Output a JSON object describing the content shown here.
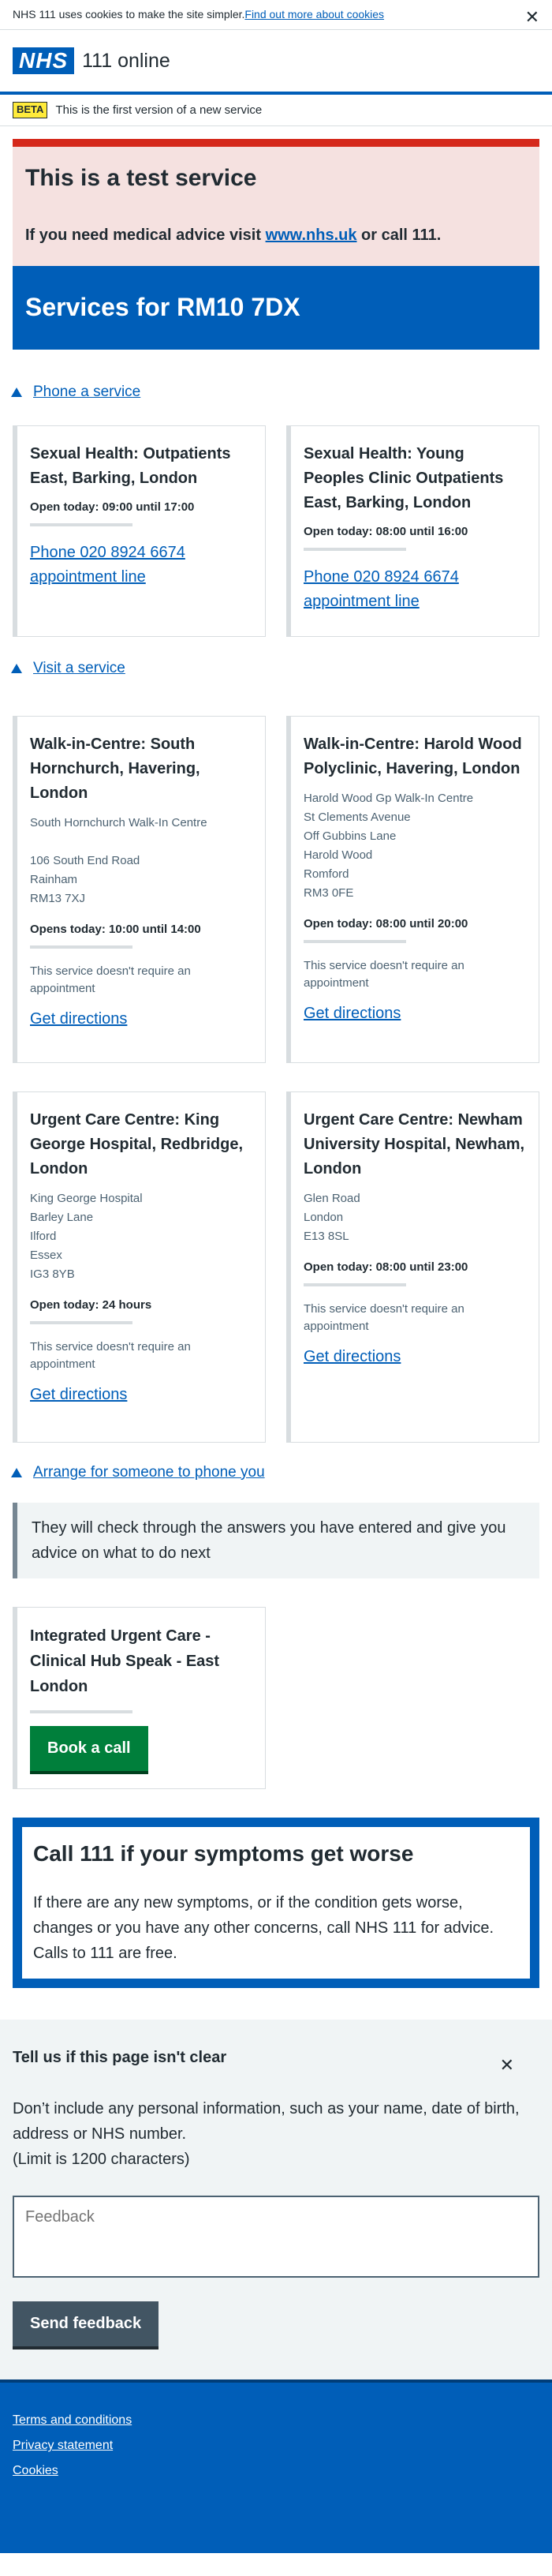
{
  "cookie_banner": {
    "text": "NHS 111 uses cookies to make the site simpler. ",
    "link": "Find out more about cookies",
    "close": "✕"
  },
  "header": {
    "logo": "NHS",
    "service_name": "111 online"
  },
  "beta": {
    "tag": "BETA",
    "text": "This is the first version of a new service"
  },
  "test_banner": {
    "title": "This is a test service",
    "text_before": "If you need medical advice visit ",
    "link": "www.nhs.uk",
    "text_after": " or call 111."
  },
  "services_title": "Services for RM10 7DX",
  "phone_section": {
    "toggle": "Phone a service",
    "cards": [
      {
        "title": "Sexual Health: Outpatients East, Barking, London",
        "open": "Open today: 09:00 until 17:00",
        "link": "Phone 020 8924 6674 appointment line"
      },
      {
        "title": "Sexual Health: Young Peoples Clinic Outpatients East, Barking, London",
        "open": "Open today: 08:00 until 16:00",
        "link": "Phone 020 8924 6674 appointment line"
      }
    ]
  },
  "visit_section": {
    "toggle": "Visit a service",
    "row1": [
      {
        "title": "Walk-in-Centre: South Hornchurch, Havering, London",
        "addr1": "South Hornchurch Walk-In Centre",
        "addr2": "106 South End Road",
        "addr3": "Rainham",
        "addr4": "RM13 7XJ",
        "open": "Opens today: 10:00 until 14:00",
        "note": "This service doesn't require an appointment",
        "link": "Get directions"
      },
      {
        "title": "Walk-in-Centre: Harold Wood Polyclinic, Havering, London",
        "addr1": "Harold Wood Gp Walk-In Centre",
        "addr2": "St Clements Avenue",
        "addr3": "Off Gubbins Lane",
        "addr4": "Harold Wood",
        "addr5": "Romford",
        "addr6": "RM3 0FE",
        "open": "Open today: 08:00 until 20:00",
        "note": "This service doesn't require an appointment",
        "link": "Get directions"
      }
    ],
    "row2": [
      {
        "title": "Urgent Care Centre: King George Hospital, Redbridge, London",
        "addr1": "King George Hospital",
        "addr2": "Barley Lane",
        "addr3": "Ilford",
        "addr4": "Essex",
        "addr5": "IG3 8YB",
        "open": "Open today: 24 hours",
        "note": "This service doesn't require an appointment",
        "link": "Get directions"
      },
      {
        "title": "Urgent Care Centre: Newham University Hospital, Newham, London",
        "addr1": "Glen Road",
        "addr2": "London",
        "addr3": "E13 8SL",
        "open": "Open today: 08:00 until 23:00",
        "note": "This service doesn't require an appointment",
        "link": "Get directions"
      }
    ]
  },
  "callback_section": {
    "toggle": "Arrange for someone to phone you",
    "inset": "They will check through the answers you have entered and give you advice on what to do next",
    "card_title": "Integrated Urgent Care - Clinical Hub Speak - East London",
    "button": "Book a call"
  },
  "care_card": {
    "title": "Call 111 if your symptoms get worse",
    "text": "If there are any new symptoms, or if the condition gets worse, changes or you have any other concerns, call NHS 111 for advice. Calls to 111 are free."
  },
  "feedback": {
    "title": "Tell us if this page isn't clear",
    "close": "✕",
    "line1": "Don’t include any personal information, such as your name, date of birth, address or NHS number.",
    "line2": "(Limit is 1200 characters)",
    "placeholder": "Feedback",
    "button": "Send feedback"
  },
  "footer": {
    "links": [
      "Terms and conditions",
      "Privacy statement",
      "Cookies"
    ]
  },
  "colors": {
    "nhs_blue": "#005eb8",
    "green": "#007f3b",
    "red": "#d5281b",
    "grey": "#425563",
    "warning_yellow": "#ffeb3b"
  }
}
